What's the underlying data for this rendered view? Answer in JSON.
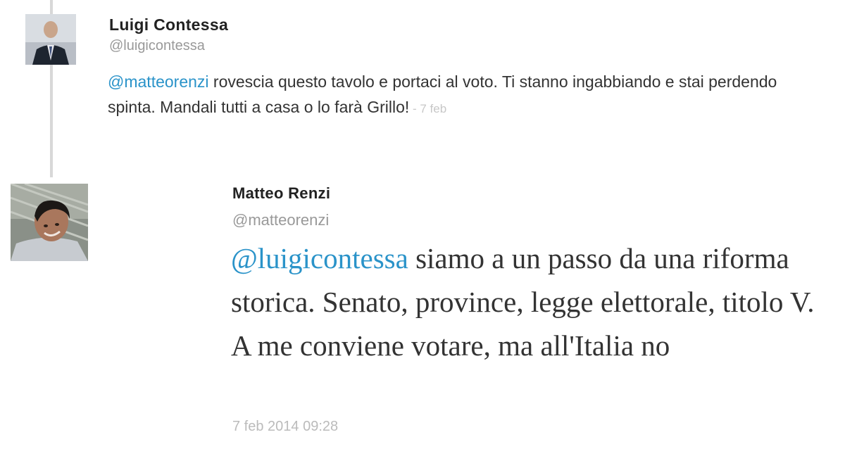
{
  "parent_tweet": {
    "author_name": "Luigi Contessa",
    "author_handle": "@luigicontessa",
    "mention": "@matteorenzi",
    "text": " rovescia questo tavolo e portaci al voto. Ti stanno ingabbiando e stai perdendo spinta. Mandali tutti a casa o lo farà Grillo!",
    "time_separator": " - ",
    "time": "7 feb"
  },
  "reply_tweet": {
    "author_name": "Matteo Renzi",
    "author_handle": "@matteorenzi",
    "mention": "@luigicontessa",
    "text": " siamo a un passo da una riforma storica. Senato, province, legge elettorale, titolo V. A me conviene votare, ma all'Italia no",
    "timestamp": "7 feb 2014 09:28"
  },
  "colors": {
    "mention": "#2a93c9",
    "text": "#333333",
    "muted": "#999999",
    "thread_line": "#d8d8d8"
  }
}
